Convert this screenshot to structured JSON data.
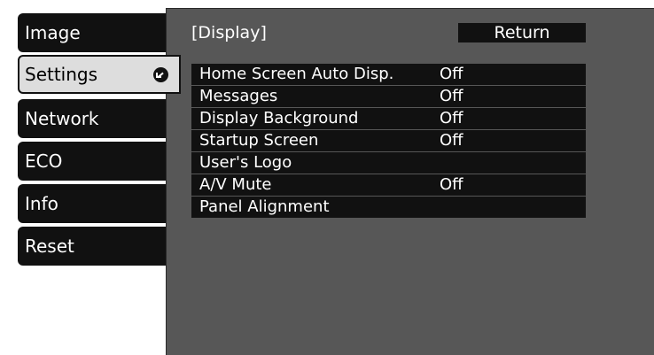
{
  "nav": {
    "items": [
      {
        "label": "Image"
      },
      {
        "label": "Settings"
      },
      {
        "label": "Network"
      },
      {
        "label": "ECO"
      },
      {
        "label": "Info"
      },
      {
        "label": "Reset"
      }
    ],
    "selected": "Settings"
  },
  "panel": {
    "title": "[Display]",
    "return_label": "Return"
  },
  "settings": {
    "rows": [
      {
        "label": "Home Screen Auto Disp.",
        "value": "Off"
      },
      {
        "label": "Messages",
        "value": "Off"
      },
      {
        "label": "Display Background",
        "value": "Off"
      },
      {
        "label": "Startup Screen",
        "value": "Off"
      },
      {
        "label": "User's Logo",
        "value": ""
      },
      {
        "label": "A/V Mute",
        "value": "Off"
      },
      {
        "label": "Panel Alignment",
        "value": ""
      }
    ]
  },
  "colors": {
    "panel_background": "#575757",
    "tab_background": "#111111",
    "selected_tab_background": "#dddddd",
    "text": "#ffffff"
  },
  "icons": {
    "selected_indicator": "enter-arrow-icon"
  }
}
